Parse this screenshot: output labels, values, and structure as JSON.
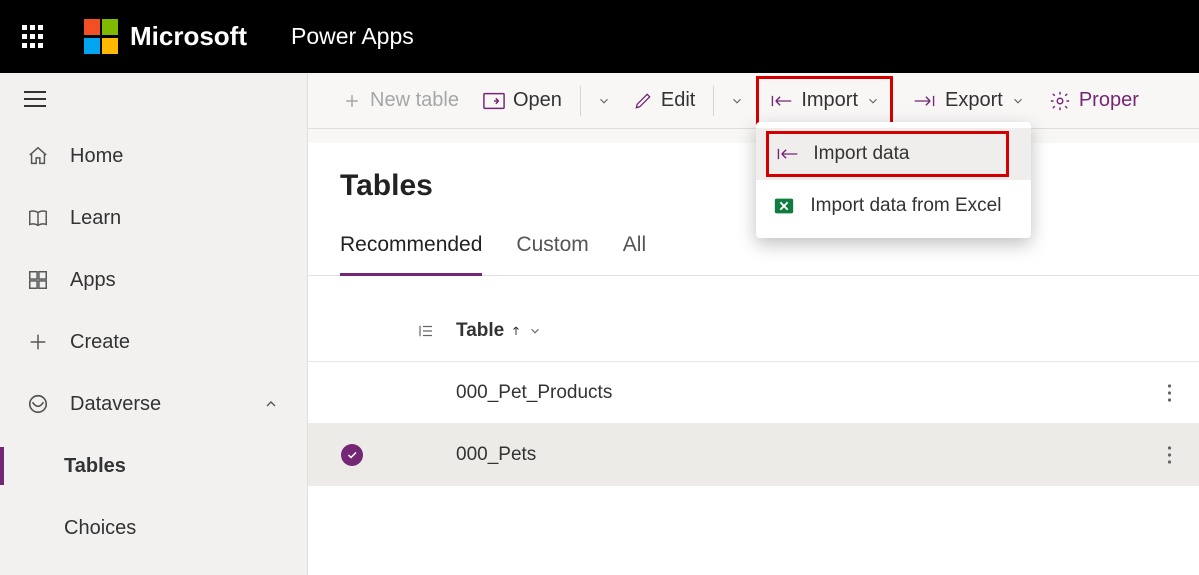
{
  "header": {
    "brand": "Microsoft",
    "app": "Power Apps"
  },
  "sidebar": {
    "items": [
      {
        "label": "Home"
      },
      {
        "label": "Learn"
      },
      {
        "label": "Apps"
      },
      {
        "label": "Create"
      },
      {
        "label": "Dataverse"
      }
    ],
    "sub": [
      {
        "label": "Tables"
      },
      {
        "label": "Choices"
      }
    ]
  },
  "cmdbar": {
    "new_table": "New table",
    "open": "Open",
    "edit": "Edit",
    "import": "Import",
    "export": "Export",
    "properties": "Proper"
  },
  "dropdown": {
    "import_data": "Import data",
    "import_excel": "Import data from Excel"
  },
  "page": {
    "title": "Tables",
    "tabs": {
      "recommended": "Recommended",
      "custom": "Custom",
      "all": "All"
    },
    "col_header": "Table",
    "rows": [
      {
        "name": "000_Pet_Products",
        "selected": false
      },
      {
        "name": "000_Pets",
        "selected": true
      }
    ]
  }
}
